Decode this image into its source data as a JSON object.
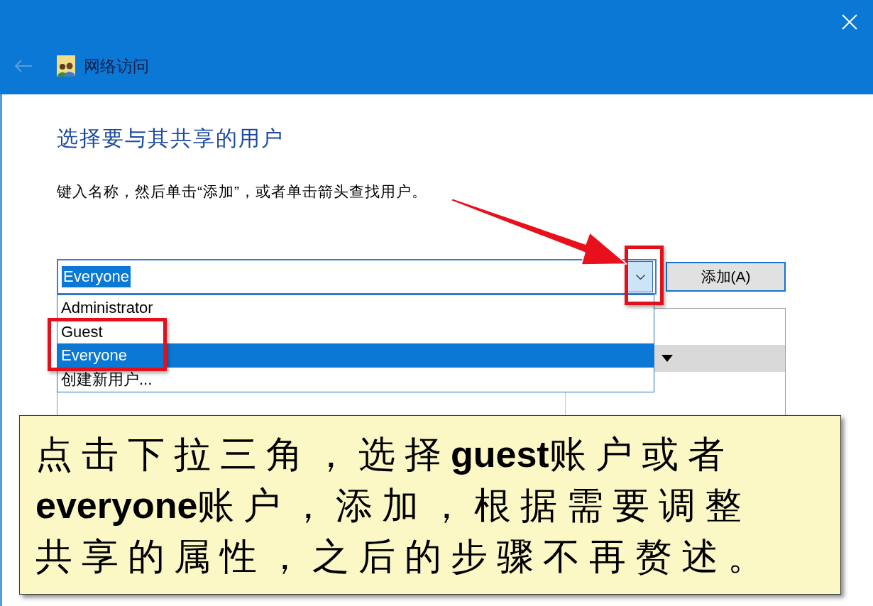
{
  "window": {
    "title": "网络访问",
    "back_button": {
      "disabled": true
    }
  },
  "heading": "选择要与其共享的用户",
  "instruction": "键入名称，然后单击“添加”，或者单击箭头查找用户。",
  "name_combo": {
    "value": "Everyone",
    "text_selected": true,
    "expanded": true
  },
  "add_button": {
    "label": "添加(A)"
  },
  "dropdown_items": [
    {
      "label": "Administrator",
      "selected": false
    },
    {
      "label": "Guest",
      "selected": false
    },
    {
      "label": "Everyone",
      "selected": true
    },
    {
      "label": "创建新用户...",
      "selected": false
    }
  ],
  "callout": {
    "text": "点击下拉三角，选择**guest**账户或者**everyone**账户，添加，根据需要调整共享的属性，之后的步骤不再赘述。"
  }
}
